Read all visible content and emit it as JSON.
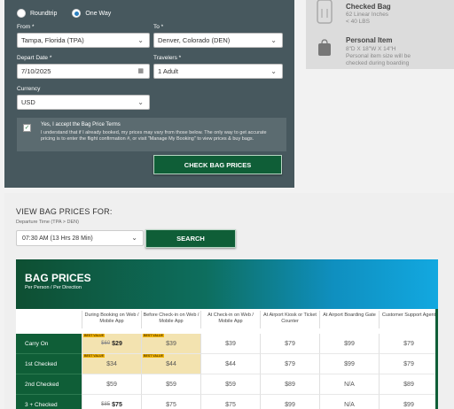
{
  "trip": {
    "roundtrip_label": "Roundtrip",
    "oneway_label": "One Way"
  },
  "form": {
    "from_label": "From *",
    "from_value": "Tampa, Florida (TPA)",
    "to_label": "To *",
    "to_value": "Denver, Colorado (DEN)",
    "date_label": "Depart Date *",
    "date_value": "7/10/2025",
    "travelers_label": "Travelers *",
    "travelers_value": "1 Adult",
    "currency_label": "Currency",
    "currency_value": "USD",
    "terms_title": "Yes, I accept the Bag Price Terms",
    "terms_text": "I understand that if I already booked, my prices may vary from those below. The only way to get accurate pricing is to enter the flight confirmation #, or visit \"Manage My Booking\" to view prices & buy bags.",
    "check_button": "CHECK BAG PRICES"
  },
  "bag_info": {
    "checked_title": "Checked Bag",
    "checked_line1": "62 Linear Inches",
    "checked_line2": "< 40 LBS",
    "personal_title": "Personal Item",
    "personal_line1": "8\"D X 18\"W X 14\"H",
    "personal_line2": "Personal item size will be",
    "personal_line3": "checked during boarding"
  },
  "view": {
    "title": "VIEW BAG PRICES FOR:",
    "dep_label": "Departure Time (TPA > DEN)",
    "dep_value": "07:30 AM (13 Hrs 28 Min)",
    "search_button": "SEARCH"
  },
  "table": {
    "title": "BAG PRICES",
    "subtitle": "Per Person / Per Direction",
    "columns": [
      "During Booking on Web / Mobile App",
      "Before Check-in on Web / Mobile App",
      "At Check-in on Web / Mobile App",
      "At Airport Kiosk or Ticket Counter",
      "At Airport Boarding Gate",
      "Customer Support Agent"
    ],
    "best_value": "BEST VALUE",
    "rows": [
      {
        "label": "Carry On",
        "old": "$60",
        "c0": "$29",
        "c1": "$39",
        "c2": "$39",
        "c3": "$79",
        "c4": "$99",
        "c5": "$79"
      },
      {
        "label": "1st Checked",
        "c0": "$34",
        "c1": "$44",
        "c2": "$44",
        "c3": "$79",
        "c4": "$99",
        "c5": "$79"
      },
      {
        "label": "2nd Checked",
        "c0": "$59",
        "c1": "$59",
        "c2": "$59",
        "c3": "$89",
        "c4": "N/A",
        "c5": "$89"
      },
      {
        "label": "3 + Checked",
        "old": "$85",
        "c0": "$75",
        "c1": "$75",
        "c2": "$75",
        "c3": "$99",
        "c4": "N/A",
        "c5": "$99"
      }
    ]
  }
}
